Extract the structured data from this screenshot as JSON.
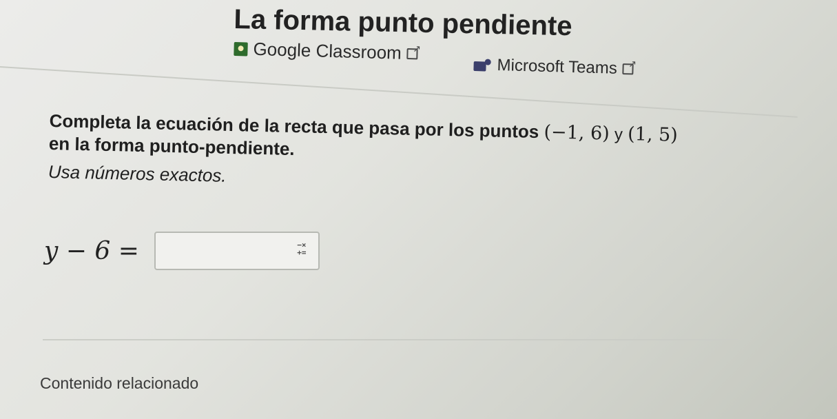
{
  "page_title": "La forma punto pendiente",
  "share": {
    "classroom_label": "Google Classroom",
    "teams_label": "Microsoft Teams"
  },
  "question": {
    "line1_text": "Completa la ecuación de la recta que pasa por los puntos",
    "point1": "(−1, 6)",
    "conjunction": "y",
    "point2": "(1, 5)",
    "line2_text": "en la forma punto-pendiente.",
    "instruction": "Usa números exactos."
  },
  "equation": {
    "label": "y − 6 =",
    "answer_value": ""
  },
  "math_keyboard": {
    "top": "−×",
    "bottom": "+="
  },
  "related": {
    "heading": "Contenido relacionado"
  }
}
